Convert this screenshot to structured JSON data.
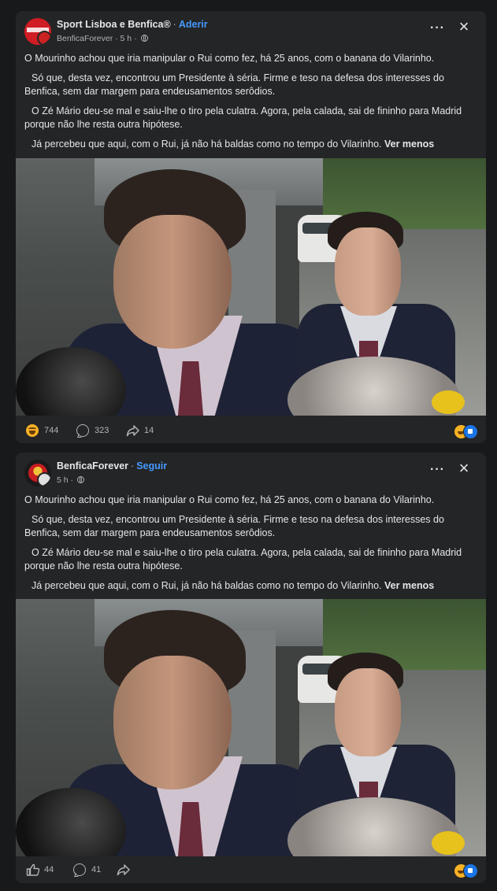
{
  "posts": [
    {
      "page_name": "Sport Lisboa e Benfica®",
      "follow_label": "Aderir",
      "author": "BenficaForever",
      "time": "5 h",
      "paragraphs": [
        "O Mourinho achou que iria manipular o Rui como fez, há 25 anos, com o banana do Vilarinho.",
        "Só que, desta vez, encontrou um Presidente à séria. Firme e teso na defesa dos interesses do Benfica, sem dar margem para endeusamentos serôdios.",
        "O Zé Mário deu-se mal e saiu-lhe o tiro pela culatra. Agora, pela calada, sai de fininho para Madrid porque não lhe resta outra hipótese.",
        "Já percebeu que aqui, com o Rui, já não há baldas como no tempo do Vilarinho."
      ],
      "see_less": "Ver menos",
      "reaction_count": "744",
      "comment_count": "323",
      "share_count": "14"
    },
    {
      "page_name": "BenficaForever",
      "follow_label": "Seguir",
      "time": "5 h",
      "paragraphs": [
        "O Mourinho achou que iria manipular o Rui como fez, há 25 anos, com o banana do Vilarinho.",
        "Só que, desta vez, encontrou um Presidente à séria. Firme e teso na defesa dos interesses do Benfica, sem dar margem para endeusamentos serôdios.",
        "O Zé Mário deu-se mal e saiu-lhe o tiro pela culatra. Agora, pela calada, sai de fininho para Madrid porque não lhe resta outra hipótese.",
        "Já percebeu que aqui, com o Rui, já não há baldas como no tempo do Vilarinho."
      ],
      "see_less": "Ver menos",
      "like_count": "44",
      "comment_count": "41"
    }
  ],
  "colors": {
    "background": "#18191a",
    "card": "#242526",
    "link": "#4599ff",
    "text": "#e4e6eb",
    "muted": "#b0b3b8"
  },
  "icons": [
    "more-icon",
    "close-icon",
    "globe-icon",
    "haha-icon",
    "comment-icon",
    "share-icon",
    "like-icon"
  ]
}
